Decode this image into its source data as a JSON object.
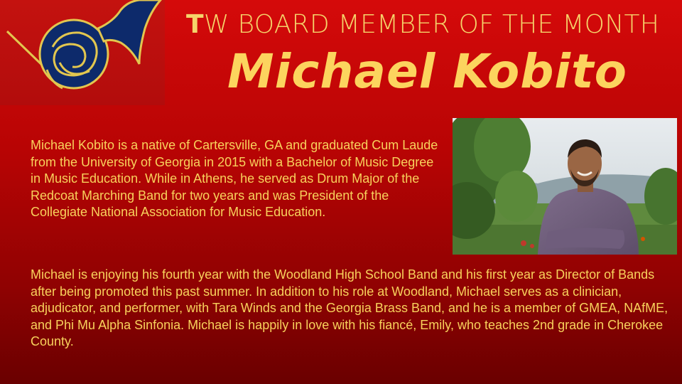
{
  "header": {
    "title_first_letter": "T",
    "title_rest": "W BOARD MEMBER OF THE MONTH",
    "member_name": "Michael Kobito"
  },
  "logo": {
    "icon": "french-horn-icon"
  },
  "photo": {
    "description_icon": "person-photo"
  },
  "bio": {
    "paragraph1": "Michael Kobito is a native of Cartersville, GA and graduated Cum Laude from the University of Georgia in 2015 with a Bachelor of Music Degree in Music Education.  While in Athens, he served as Drum Major of the Redcoat Marching Band for two years and was President of the Collegiate National Association for Music Education.",
    "paragraph2": "Michael is enjoying his fourth year with the Woodland High School Band and his first year as Director of Bands after being promoted this past summer.  In addition to his role at Woodland, Michael serves as a clinician, adjudicator, and performer, with Tara Winds and the Georgia Brass Band, and he is a member of GMEA, NAfME, and Phi Mu Alpha Sinfonia.  Michael is happily in love with his fiancé, Emily, who teaches 2nd grade in Cherokee County."
  },
  "colors": {
    "background_top": "#d50a0a",
    "background_bottom": "#6a0000",
    "text_gold": "#f8d25c",
    "logo_navy": "#0d2a6b"
  }
}
